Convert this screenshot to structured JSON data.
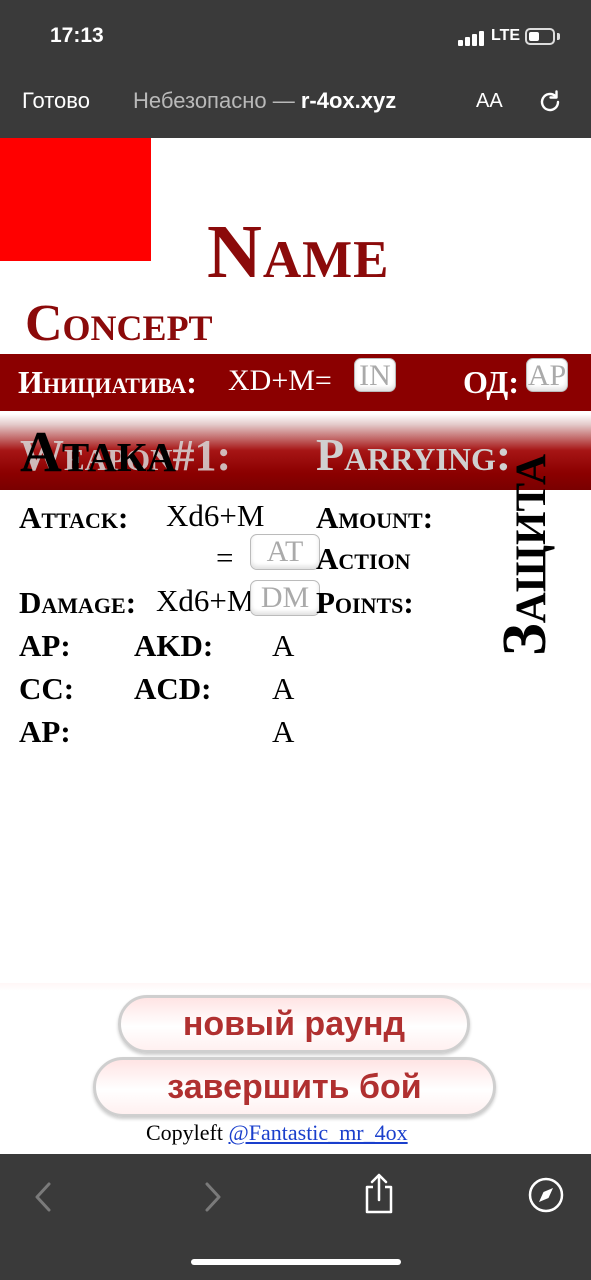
{
  "status": {
    "time": "17:13",
    "carrier": "LTE"
  },
  "browser": {
    "done_label": "Готово",
    "url_prefix": "Небезопасно — ",
    "url_fragment": "r-4ox.xyz",
    "text_size_label": "AA"
  },
  "sheet": {
    "name": "Name",
    "concept": "Concept",
    "initiative_label": "Инициатива:",
    "initiative_formula": "XD+M=",
    "initiative_box": "IN",
    "od_label": "ОД:",
    "od_box": "AP",
    "weapon_label": "Weapon#1:",
    "attack_title": "Атака",
    "parrying_label": "Parrying:",
    "defense_title": "Защита",
    "attack_label": "Attack:",
    "attack_formula": "Xd6+M",
    "equals": "=",
    "attack_box": "AT",
    "damage_label": "Damage:",
    "damage_formula": "Xd6+M",
    "damage_box": "DM",
    "amount_label": "Amount:",
    "action_label": "Action",
    "points_label": "Points:",
    "stats": [
      {
        "label": "AP:",
        "label2": "AKD:",
        "value": "A"
      },
      {
        "label": "CC:",
        "label2": "ACD:",
        "value": "A"
      },
      {
        "label": "AP:",
        "label2": "",
        "value": "A"
      }
    ]
  },
  "buttons": {
    "new_round": "новый раунд",
    "end_battle": "завершить бой"
  },
  "footer": {
    "copyleft_text": "Copyleft ",
    "author_link": "@Fantastic_mr_4ox"
  },
  "colors": {
    "accent": "#8b0000",
    "title": "#8b0a0a",
    "red_square": "#ff0000"
  }
}
